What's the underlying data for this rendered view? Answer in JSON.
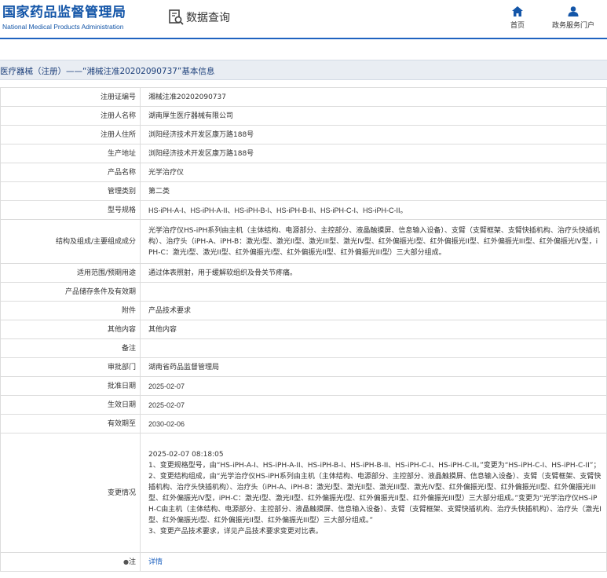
{
  "header": {
    "logo_cn": "国家药品监督管理局",
    "logo_en": "National Medical Products Administration",
    "section_title": "数据查询",
    "nav": [
      {
        "label": "首页",
        "icon": "home-icon"
      },
      {
        "label": "政务服务门户",
        "icon": "user-icon"
      }
    ]
  },
  "colors": {
    "brand": "#1456a8",
    "accent": "#1f63c0",
    "crumb_bg": "#e9edf3"
  },
  "breadcrumb": "医疗器械（注册）——“湘械注准20202090737”基本信息",
  "rows": [
    {
      "label": "注册证编号",
      "value": "湘械注准20202090737"
    },
    {
      "label": "注册人名称",
      "value": "湖南厚生医疗器械有限公司"
    },
    {
      "label": "注册人住所",
      "value": "浏阳经济技术开发区康万路188号"
    },
    {
      "label": "生产地址",
      "value": "浏阳经济技术开发区康万路188号"
    },
    {
      "label": "产品名称",
      "value": "光学治疗仪"
    },
    {
      "label": "管理类别",
      "value": "第二类"
    },
    {
      "label": "型号规格",
      "value": "HS-iPH-A-I、HS-iPH-A-II、HS-iPH-B-I、HS-iPH-B-II、HS-iPH-C-I、HS-iPH-C-II。"
    },
    {
      "label": "结构及组成/主要组成成分",
      "value": "光学治疗仪HS-iPH系列由主机（主体结构、电源部分、主控部分、液晶触摸屏、信息输入设备）、支臂（支臂框架、支臂快插机构、治疗头快插机构）、治疗头（iPH-A、iPH-B：激光I型、激光II型、激光III型、激光IV型、红外偏振光I型、红外偏振光II型、红外偏振光III型、红外偏振光IV型，iPH-C：激光I型、激光II型、红外偏振光I型、红外偏振光II型、红外偏振光III型）三大部分组成。"
    },
    {
      "label": "适用范围/预期用途",
      "value": "通过体表照射，用于缓解软组织及骨关节疼痛。"
    },
    {
      "label": "产品储存条件及有效期",
      "value": ""
    },
    {
      "label": "附件",
      "value": "产品技术要求"
    },
    {
      "label": "其他内容",
      "value": "其他内容"
    },
    {
      "label": "备注",
      "value": ""
    },
    {
      "label": "审批部门",
      "value": "湖南省药品监督管理局"
    },
    {
      "label": "批准日期",
      "value": "2025-02-07"
    },
    {
      "label": "生效日期",
      "value": "2025-02-07"
    },
    {
      "label": "有效期至",
      "value": "2030-02-06"
    }
  ],
  "change": {
    "label": "变更情况",
    "lines": [
      "2025-02-07 08:18:05",
      "1、变更规格型号，由“HS-iPH-A-I、HS-iPH-A-II、HS-iPH-B-I、HS-iPH-B-II、HS-iPH-C-I、HS-iPH-C-II。”变更为“HS-iPH-C-I、HS-iPH-C-II”；",
      "2、变更结构组成，由“光学治疗仪HS-iPH系列由主机（主体结构、电源部分、主控部分、液晶触摸屏、信息输入设备）、支臂（支臂框架、支臂快插机构、治疗头快插机构）、治疗头（iPH-A、iPH-B：激光I型、激光II型、激光III型、激光IV型、红外偏振光I型、红外偏振光II型、红外偏振光III型、红外偏振光IV型，iPH-C：激光I型、激光II型、红外偏振光I型、红外偏振光II型、红外偏振光III型）三大部分组成。”变更为“光学治疗仪HS-iPH-C由主机（主体结构、电源部分、主控部分、液晶触摸屏、信息输入设备）、支臂（支臂框架、支臂快插机构、治疗头快插机构）、治疗头（激光I型、红外偏振光I型、红外偏振光II型、红外偏振光III型）三大部分组成。”",
      "3、变更产品技术要求，详见产品技术要求变更对比表。"
    ]
  },
  "note": {
    "label": "注",
    "link": "详情"
  }
}
